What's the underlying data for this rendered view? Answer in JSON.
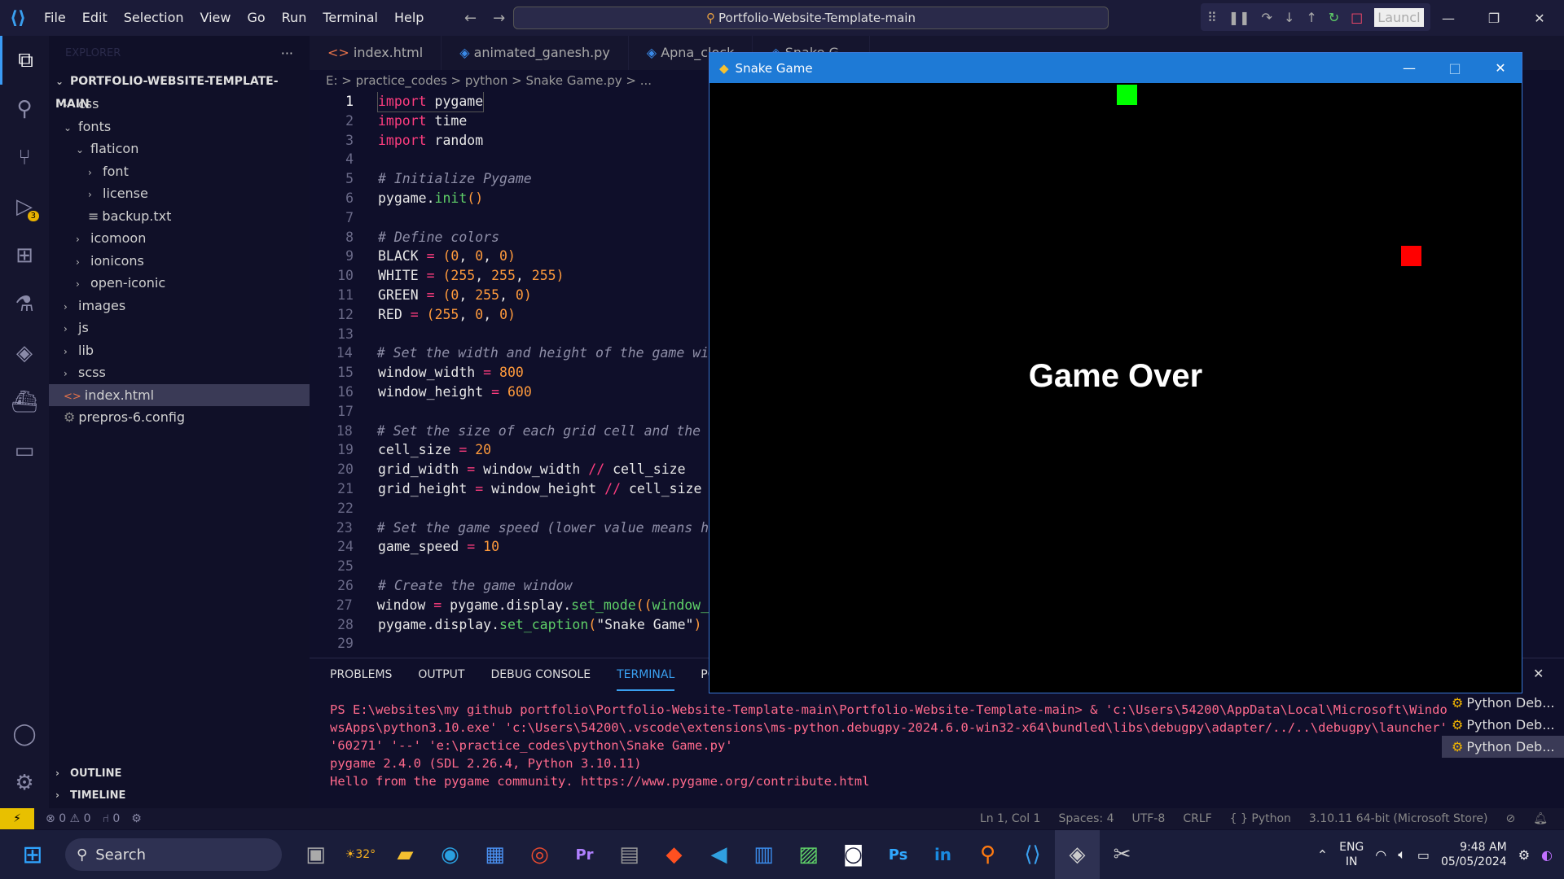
{
  "menu": [
    "File",
    "Edit",
    "Selection",
    "View",
    "Go",
    "Run",
    "Terminal",
    "Help"
  ],
  "command_center": "Portfolio-Website-Template-main",
  "debug": {
    "launch_label": "Launcl"
  },
  "sidebar": {
    "explorer_label": "EXPLORER",
    "project": "PORTFOLIO-WEBSITE-TEMPLATE-MAIN",
    "tree": [
      {
        "label": "css",
        "indent": 1,
        "kind": "folder-closed"
      },
      {
        "label": "fonts",
        "indent": 1,
        "kind": "folder-open"
      },
      {
        "label": "flaticon",
        "indent": 2,
        "kind": "folder-open"
      },
      {
        "label": "font",
        "indent": 3,
        "kind": "folder-closed"
      },
      {
        "label": "license",
        "indent": 3,
        "kind": "folder-closed"
      },
      {
        "label": "backup.txt",
        "indent": 3,
        "kind": "txt"
      },
      {
        "label": "icomoon",
        "indent": 2,
        "kind": "folder-closed"
      },
      {
        "label": "ionicons",
        "indent": 2,
        "kind": "folder-closed"
      },
      {
        "label": "open-iconic",
        "indent": 2,
        "kind": "folder-closed"
      },
      {
        "label": "images",
        "indent": 1,
        "kind": "folder-closed"
      },
      {
        "label": "js",
        "indent": 1,
        "kind": "folder-closed"
      },
      {
        "label": "lib",
        "indent": 1,
        "kind": "folder-closed"
      },
      {
        "label": "scss",
        "indent": 1,
        "kind": "folder-closed"
      },
      {
        "label": "index.html",
        "indent": 1,
        "kind": "html",
        "selected": true
      },
      {
        "label": "prepros-6.config",
        "indent": 1,
        "kind": "config"
      }
    ],
    "outline": "OUTLINE",
    "timeline": "TIMELINE"
  },
  "tabs": [
    "index.html",
    "animated_ganesh.py",
    "Apna_clock",
    "Snake G..."
  ],
  "breadcrumb": "E: > practice_codes > python > Snake Game.py > ...",
  "code": [
    [
      [
        "kw",
        "import"
      ],
      [
        "st",
        " pygame"
      ]
    ],
    [
      [
        "kw",
        "import"
      ],
      [
        "st",
        " time"
      ]
    ],
    [
      [
        "kw",
        "import"
      ],
      [
        "st",
        " random"
      ]
    ],
    [],
    [
      [
        "cm",
        "# Initialize Pygame"
      ]
    ],
    [
      [
        "st",
        "pygame."
      ],
      [
        "fn",
        "init"
      ],
      [
        "nm",
        "()"
      ]
    ],
    [],
    [
      [
        "cm",
        "# Define colors"
      ]
    ],
    [
      [
        "st",
        "BLACK "
      ],
      [
        "op",
        "="
      ],
      [
        "nm",
        " ("
      ],
      [
        "nm",
        "0"
      ],
      [
        "st",
        ", "
      ],
      [
        "nm",
        "0"
      ],
      [
        "st",
        ", "
      ],
      [
        "nm",
        "0"
      ],
      [
        "nm",
        ")"
      ]
    ],
    [
      [
        "st",
        "WHITE "
      ],
      [
        "op",
        "="
      ],
      [
        "nm",
        " ("
      ],
      [
        "nm",
        "255"
      ],
      [
        "st",
        ", "
      ],
      [
        "nm",
        "255"
      ],
      [
        "st",
        ", "
      ],
      [
        "nm",
        "255"
      ],
      [
        "nm",
        ")"
      ]
    ],
    [
      [
        "st",
        "GREEN "
      ],
      [
        "op",
        "="
      ],
      [
        "nm",
        " ("
      ],
      [
        "nm",
        "0"
      ],
      [
        "st",
        ", "
      ],
      [
        "nm",
        "255"
      ],
      [
        "st",
        ", "
      ],
      [
        "nm",
        "0"
      ],
      [
        "nm",
        ")"
      ]
    ],
    [
      [
        "st",
        "RED "
      ],
      [
        "op",
        "="
      ],
      [
        "nm",
        " ("
      ],
      [
        "nm",
        "255"
      ],
      [
        "st",
        ", "
      ],
      [
        "nm",
        "0"
      ],
      [
        "st",
        ", "
      ],
      [
        "nm",
        "0"
      ],
      [
        "nm",
        ")"
      ]
    ],
    [],
    [
      [
        "cm",
        "# Set the width and height of the game win"
      ]
    ],
    [
      [
        "st",
        "window_width "
      ],
      [
        "op",
        "="
      ],
      [
        "nm",
        " 800"
      ]
    ],
    [
      [
        "st",
        "window_height "
      ],
      [
        "op",
        "="
      ],
      [
        "nm",
        " 600"
      ]
    ],
    [],
    [
      [
        "cm",
        "# Set the size of each grid cell and the n"
      ]
    ],
    [
      [
        "st",
        "cell_size "
      ],
      [
        "op",
        "="
      ],
      [
        "nm",
        " 20"
      ]
    ],
    [
      [
        "st",
        "grid_width "
      ],
      [
        "op",
        "="
      ],
      [
        "st",
        " window_width "
      ],
      [
        "op",
        "//"
      ],
      [
        "st",
        " cell_size"
      ]
    ],
    [
      [
        "st",
        "grid_height "
      ],
      [
        "op",
        "="
      ],
      [
        "st",
        " window_height "
      ],
      [
        "op",
        "//"
      ],
      [
        "st",
        " cell_size"
      ]
    ],
    [],
    [
      [
        "cm",
        "# Set the game speed (lower value means hi"
      ]
    ],
    [
      [
        "st",
        "game_speed "
      ],
      [
        "op",
        "="
      ],
      [
        "nm",
        " 10"
      ]
    ],
    [],
    [
      [
        "cm",
        "# Create the game window"
      ]
    ],
    [
      [
        "st",
        "window "
      ],
      [
        "op",
        "="
      ],
      [
        "st",
        " pygame.display."
      ],
      [
        "fn",
        "set_mode"
      ],
      [
        "nm",
        "(("
      ],
      [
        "fn",
        "window_w"
      ]
    ],
    [
      [
        "st",
        "pygame.display."
      ],
      [
        "fn",
        "set_caption"
      ],
      [
        "nm",
        "("
      ],
      [
        "st",
        "\"Snake Game\""
      ],
      [
        "nm",
        ")"
      ]
    ],
    []
  ],
  "panel": {
    "tabs": [
      "PROBLEMS",
      "OUTPUT",
      "DEBUG CONSOLE",
      "TERMINAL",
      "PORTS"
    ],
    "active_tab": "TERMINAL",
    "terminal_lines": [
      "PS E:\\websites\\my github portfolio\\Portfolio-Website-Template-main\\Portfolio-Website-Template-main>  & 'c:\\Users\\54200\\AppData\\Local\\Microsoft\\Windo",
      "wsApps\\python3.10.exe' 'c:\\Users\\54200\\.vscode\\extensions\\ms-python.debugpy-2024.6.0-win32-x64\\bundled\\libs\\debugpy\\adapter/../..\\debugpy\\launcher'",
      "'60271' '--' 'e:\\practice_codes\\python\\Snake Game.py'",
      "pygame 2.4.0 (SDL 2.26.4, Python 3.10.11)",
      "Hello from the pygame community. https://www.pygame.org/contribute.html"
    ],
    "terminal_list": [
      "Python Deb...",
      "Python Deb...",
      "Python Deb..."
    ]
  },
  "status": {
    "errors": "0",
    "warnings": "0",
    "ports": "0",
    "position": "Ln 1, Col 1",
    "spaces": "Spaces: 4",
    "encoding": "UTF-8",
    "eol": "CRLF",
    "language": "Python",
    "interpreter": "3.10.11 64-bit (Microsoft Store)"
  },
  "taskbar": {
    "search": "Search",
    "weather": "32°",
    "lang1": "ENG",
    "lang2": "IN",
    "time": "9:48 AM",
    "date": "05/05/2024"
  },
  "game": {
    "title": "Snake Game",
    "message": "Game Over",
    "snake_color": "#00ff00",
    "food_color": "#ff0000"
  },
  "activity_badge": "3"
}
